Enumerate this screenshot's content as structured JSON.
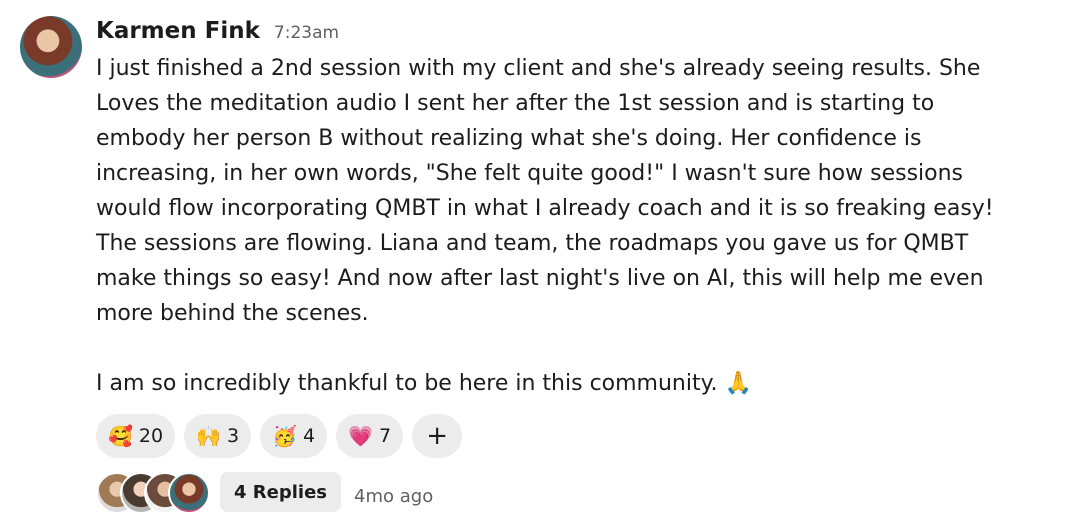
{
  "message": {
    "author": "Karmen Fink",
    "time": "7:23am",
    "lines": [
      "I just finished a 2nd session with my client and she's already seeing results. She",
      "Loves the meditation audio I sent her after the 1st session and is starting to",
      "embody her person B without realizing what she's doing. Her confidence is",
      "increasing, in her own words, \"She felt quite good!\" I wasn't sure how sessions",
      "would flow incorporating QMBT in what I already coach and it is so freaking easy!",
      "The sessions are flowing. Liana and team, the roadmaps you gave us for QMBT",
      "make things so easy! And now after last night's live on AI, this will help me even",
      "more behind the scenes."
    ],
    "closing": "I am so incredibly thankful to be here in this community. 🙏"
  },
  "reactions": [
    {
      "emoji": "🥰",
      "count": "20"
    },
    {
      "emoji": "🙌",
      "count": "3"
    },
    {
      "emoji": "🥳",
      "count": "4"
    },
    {
      "emoji": "💗",
      "count": "7"
    }
  ],
  "add_reaction": "+",
  "replies": {
    "label": "4 Replies",
    "ago": "4mo ago"
  }
}
